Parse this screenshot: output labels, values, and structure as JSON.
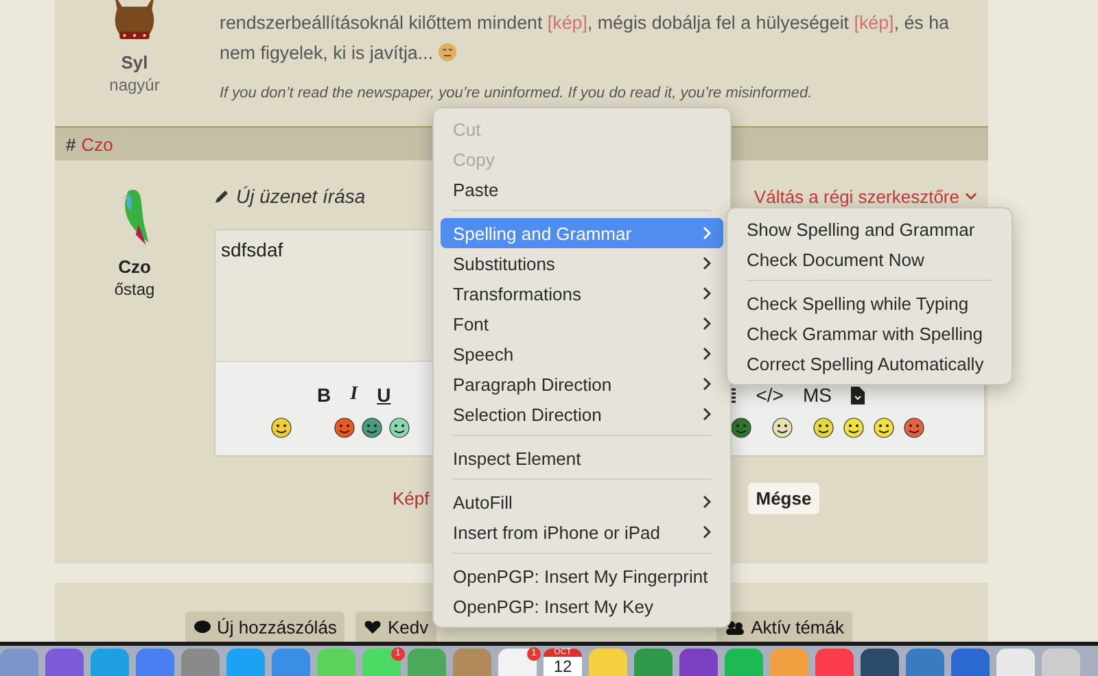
{
  "post": {
    "author": "Syl",
    "rank": "nagyúr",
    "body": [
      {
        "text": "rendszerbeállításoknál kilőttem mindent "
      },
      {
        "text": "[kép]",
        "kind": "link"
      },
      {
        "text": ", mégis dobálja fel a hülyeségeit "
      },
      {
        "text": "[kép]",
        "kind": "link"
      },
      {
        "text": ", és ha nem figyelek, ki is javítja..."
      }
    ],
    "signature": "If you don’t read the newspaper, you’re uninformed. If you do read it, you’re misinformed."
  },
  "reply_header": {
    "hash": "#",
    "user": "Czo"
  },
  "editor": {
    "author": "Czo",
    "rank": "őstag",
    "title": "Új üzenet írása",
    "switch_link": "Váltás a régi szerkesztőre",
    "value": "sdfsdaf",
    "format_buttons": [
      {
        "kind": "bold",
        "label": "B"
      },
      {
        "kind": "italic",
        "label": "I"
      },
      {
        "kind": "underline",
        "label": "U"
      },
      {
        "kind": "list"
      },
      {
        "kind": "text",
        "label": "</>"
      },
      {
        "kind": "text",
        "label": "MS"
      },
      {
        "kind": "file"
      }
    ]
  },
  "form_actions": {
    "link": "Képf",
    "cancel": "Mégse"
  },
  "bottom_buttons": [
    {
      "kind": "bubble",
      "label": "Új hozzászólás"
    },
    {
      "kind": "heart",
      "label": "Kedv"
    },
    {
      "kind": "people",
      "label": "Aktív témák"
    }
  ],
  "context_menu": {
    "items": [
      {
        "kind": "item",
        "label": "Cut",
        "disabled": true,
        "submenu": false,
        "selected": false
      },
      {
        "kind": "item",
        "label": "Copy",
        "disabled": true,
        "submenu": false,
        "selected": false
      },
      {
        "kind": "item",
        "label": "Paste",
        "disabled": false,
        "submenu": false,
        "selected": false
      },
      {
        "kind": "separator"
      },
      {
        "kind": "item",
        "label": "Spelling and Grammar",
        "disabled": false,
        "submenu": true,
        "selected": true
      },
      {
        "kind": "item",
        "label": "Substitutions",
        "disabled": false,
        "submenu": true,
        "selected": false
      },
      {
        "kind": "item",
        "label": "Transformations",
        "disabled": false,
        "submenu": true,
        "selected": false
      },
      {
        "kind": "item",
        "label": "Font",
        "disabled": false,
        "submenu": true,
        "selected": false
      },
      {
        "kind": "item",
        "label": "Speech",
        "disabled": false,
        "submenu": true,
        "selected": false
      },
      {
        "kind": "item",
        "label": "Paragraph Direction",
        "disabled": false,
        "submenu": true,
        "selected": false
      },
      {
        "kind": "item",
        "label": "Selection Direction",
        "disabled": false,
        "submenu": true,
        "selected": false
      },
      {
        "kind": "separator"
      },
      {
        "kind": "item",
        "label": "Inspect Element",
        "disabled": false,
        "submenu": false,
        "selected": false
      },
      {
        "kind": "separator"
      },
      {
        "kind": "item",
        "label": "AutoFill",
        "disabled": false,
        "submenu": true,
        "selected": false
      },
      {
        "kind": "item",
        "label": "Insert from iPhone or iPad",
        "disabled": false,
        "submenu": true,
        "selected": false
      },
      {
        "kind": "separator"
      },
      {
        "kind": "item",
        "label": "OpenPGP: Insert My Fingerprint",
        "disabled": false,
        "submenu": false,
        "selected": false
      },
      {
        "kind": "item",
        "label": "OpenPGP: Insert My Key",
        "disabled": false,
        "submenu": false,
        "selected": false
      }
    ]
  },
  "submenu": {
    "items": [
      {
        "kind": "item",
        "label": "Show Spelling and Grammar"
      },
      {
        "kind": "item",
        "label": "Check Document Now"
      },
      {
        "kind": "separator"
      },
      {
        "kind": "item",
        "label": "Check Spelling while Typing"
      },
      {
        "kind": "item",
        "label": "Check Grammar with Spelling"
      },
      {
        "kind": "item",
        "label": "Correct Spelling Automatically"
      }
    ]
  },
  "dock": {
    "items": [
      {
        "kind": "app"
      },
      {
        "kind": "app"
      },
      {
        "kind": "app"
      },
      {
        "kind": "app"
      },
      {
        "kind": "app"
      },
      {
        "kind": "app"
      },
      {
        "kind": "app"
      },
      {
        "kind": "app"
      },
      {
        "kind": "app",
        "badge": "1"
      },
      {
        "kind": "app"
      },
      {
        "kind": "app"
      },
      {
        "kind": "app",
        "badge": "1"
      },
      {
        "kind": "calendar",
        "month": "OCT",
        "day": "12"
      },
      {
        "kind": "app"
      },
      {
        "kind": "app"
      },
      {
        "kind": "app"
      },
      {
        "kind": "app"
      },
      {
        "kind": "app"
      },
      {
        "kind": "app"
      },
      {
        "kind": "app"
      },
      {
        "kind": "app"
      },
      {
        "kind": "app"
      },
      {
        "kind": "app"
      },
      {
        "kind": "app"
      }
    ]
  }
}
